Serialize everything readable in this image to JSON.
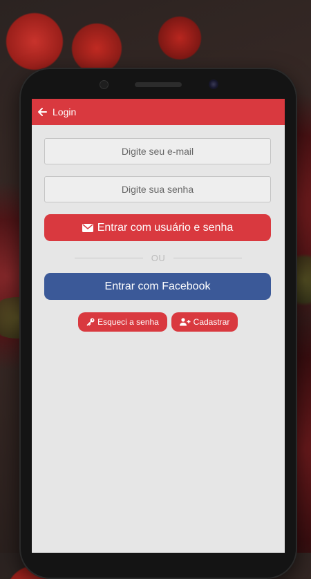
{
  "appbar": {
    "title": "Login"
  },
  "form": {
    "email_placeholder": "Digite seu e-mail",
    "password_placeholder": "Digite sua senha",
    "login_button": "Entrar com usuário e senha",
    "divider": "OU",
    "facebook_button": "Entrar com Facebook",
    "forgot_button": "Esqueci a senha",
    "register_button": "Cadastrar"
  },
  "colors": {
    "primary": "#d9393f",
    "facebook": "#3b5998",
    "screen_bg": "#e6e6e6"
  },
  "icons": {
    "back": "arrow-left-icon",
    "login": "envelope-icon",
    "forgot": "key-icon",
    "register": "user-plus-icon"
  }
}
